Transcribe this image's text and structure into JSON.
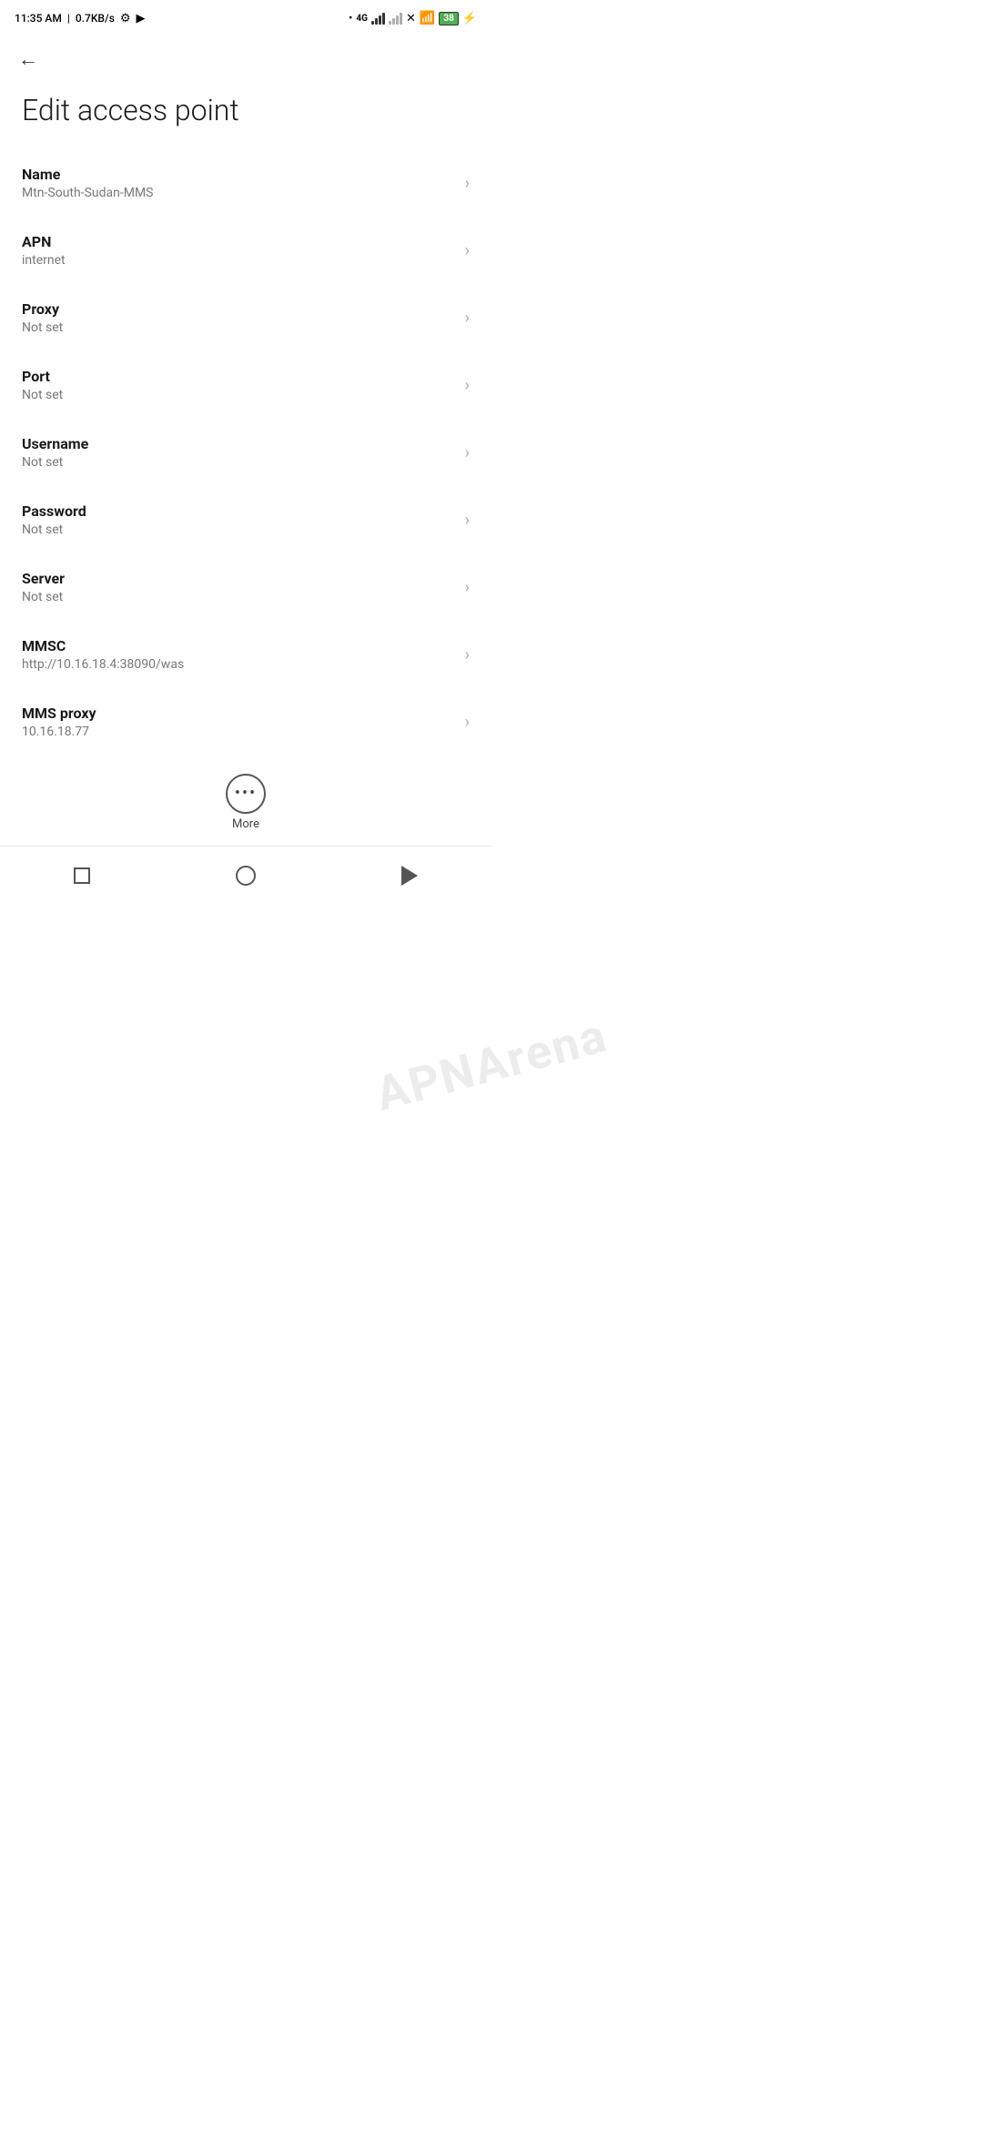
{
  "statusBar": {
    "time": "11:35 AM",
    "speed": "0.7KB/s",
    "battery": "38"
  },
  "topNav": {
    "backLabel": "←"
  },
  "page": {
    "title": "Edit access point"
  },
  "settings": [
    {
      "label": "Name",
      "value": "Mtn-South-Sudan-MMS"
    },
    {
      "label": "APN",
      "value": "internet"
    },
    {
      "label": "Proxy",
      "value": "Not set"
    },
    {
      "label": "Port",
      "value": "Not set"
    },
    {
      "label": "Username",
      "value": "Not set"
    },
    {
      "label": "Password",
      "value": "Not set"
    },
    {
      "label": "Server",
      "value": "Not set"
    },
    {
      "label": "MMSC",
      "value": "http://10.16.18.4:38090/was"
    },
    {
      "label": "MMS proxy",
      "value": "10.16.18.77"
    }
  ],
  "more": {
    "label": "More"
  },
  "watermark": "APNArena"
}
